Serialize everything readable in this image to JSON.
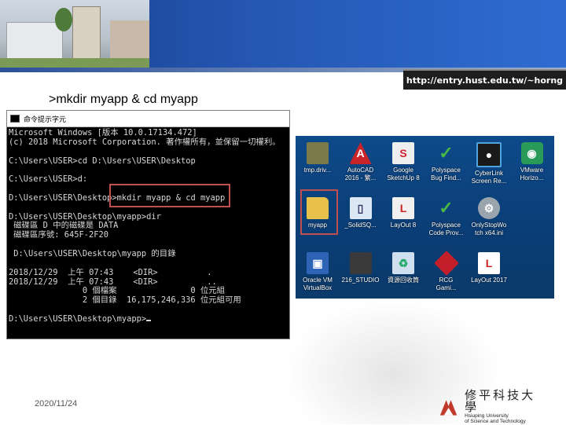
{
  "header": {
    "url": "http://entry.hust.edu.tw/~horng"
  },
  "slide": {
    "command_title": ">mkdir myapp & cd myapp",
    "date": "2020/11/24"
  },
  "console": {
    "window_title": "命令提示字元",
    "lines": [
      "Microsoft Windows [版本 10.0.17134.472]",
      "(c) 2018 Microsoft Corporation. 著作權所有，並保留一切權利。",
      "",
      "C:\\Users\\USER>cd D:\\Users\\USER\\Desktop",
      "",
      "C:\\Users\\USER>d:",
      "",
      "D:\\Users\\USER\\Desktop>mkdir myapp & cd myapp",
      "",
      "D:\\Users\\USER\\Desktop\\myapp>dir",
      " 磁碟區 D 中的磁碟是 DATA",
      " 磁碟區序號: 645F-2F20",
      "",
      " D:\\Users\\USER\\Desktop\\myapp 的目錄",
      "",
      "2018/12/29  上午 07:43    <DIR>          .",
      "2018/12/29  上午 07:43    <DIR>          ..",
      "               0 個檔案               0 位元組",
      "               2 個目錄  16,175,246,336 位元組可用",
      "",
      "D:\\Users\\USER\\Desktop\\myapp>"
    ]
  },
  "desktop": {
    "icons": [
      {
        "label": "tmp.driv...",
        "glyph": "",
        "style": "g-folder-dark",
        "icon": "folder-icon"
      },
      {
        "label": "AutoCAD\n2016 - 繁...",
        "glyph": "A",
        "style": "g-red",
        "icon": "autocad-icon"
      },
      {
        "label": "Google\nSketchUp 8",
        "glyph": "S",
        "style": "g-sketch",
        "icon": "sketchup-icon"
      },
      {
        "label": "Polyspace\nBug Find...",
        "glyph": "✓",
        "style": "g-poly",
        "icon": "polyspace-icon"
      },
      {
        "label": "CyberLink\nScreen Re...",
        "glyph": "●",
        "style": "g-cyber",
        "icon": "cyberlink-icon"
      },
      {
        "label": "VMware\nHorizo...",
        "glyph": "◉",
        "style": "g-vmw",
        "icon": "vmware-icon"
      },
      {
        "label": "myapp",
        "glyph": "",
        "style": "g-folder",
        "icon": "folder-icon"
      },
      {
        "label": "_SolidSQ...",
        "glyph": "▯",
        "style": "g-file",
        "icon": "file-icon"
      },
      {
        "label": "LayOut 8",
        "glyph": "L",
        "style": "g-layout",
        "icon": "layout-icon"
      },
      {
        "label": "Polyspace\nCode Prov...",
        "glyph": "✓",
        "style": "g-poly",
        "icon": "polyspace-icon"
      },
      {
        "label": "OnlyStopWo\ntch x64.ini",
        "glyph": "⚙",
        "style": "g-gear",
        "icon": "gear-icon"
      },
      {
        "label": "",
        "glyph": "",
        "style": "",
        "icon": "empty-slot"
      },
      {
        "label": "Oracle VM\nVirtualBox",
        "glyph": "▣",
        "style": "g-vbox",
        "icon": "virtualbox-icon"
      },
      {
        "label": "216_STUDIO",
        "glyph": "",
        "style": "g-dark",
        "icon": "folder-icon"
      },
      {
        "label": "資源回收筒",
        "glyph": "♻",
        "style": "g-bin",
        "icon": "recycle-bin-icon"
      },
      {
        "label": "RCG\nGami...",
        "glyph": "",
        "style": "g-rcg",
        "icon": "rcg-icon"
      },
      {
        "label": "LayOut 2017",
        "glyph": "L",
        "style": "g-lay17",
        "icon": "layout-icon"
      }
    ]
  },
  "logo": {
    "cn": "修平科技大學",
    "en_line1": "Hsiuping University",
    "en_line2": "of Science and Technology",
    "colors": {
      "mark": "#c0392b"
    }
  }
}
